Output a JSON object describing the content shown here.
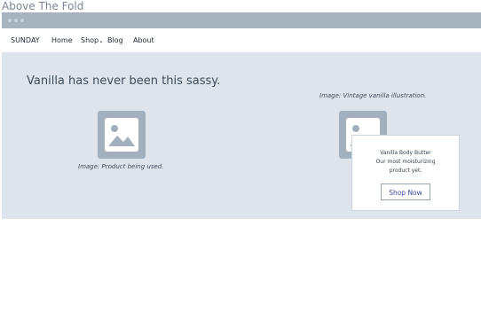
{
  "page": {
    "heading": "Above The Fold"
  },
  "nav": {
    "brand": "SUNDAY",
    "items": [
      {
        "label": "Home"
      },
      {
        "label": "Shop",
        "icon": "chevron-down-icon"
      },
      {
        "label": "Blog"
      },
      {
        "label": "About"
      }
    ]
  },
  "hero": {
    "headline": "Vanilla has never been this sassy.",
    "left_image": {
      "icon": "image-placeholder-icon",
      "caption": "Image: Product being used."
    },
    "right_image": {
      "icon": "image-placeholder-icon",
      "caption": "Image: Vintage vanilla illustration."
    }
  },
  "promo": {
    "title": "Vanilla Body Butter",
    "line1": "Our most moisturizing",
    "line2": "product yet.",
    "button": "Shop Now"
  },
  "colors": {
    "hero_background": "#dde4ec",
    "titlebar": "#a7b3bf",
    "placeholder": "#a2afbc",
    "button_text": "#3b4aa1"
  }
}
